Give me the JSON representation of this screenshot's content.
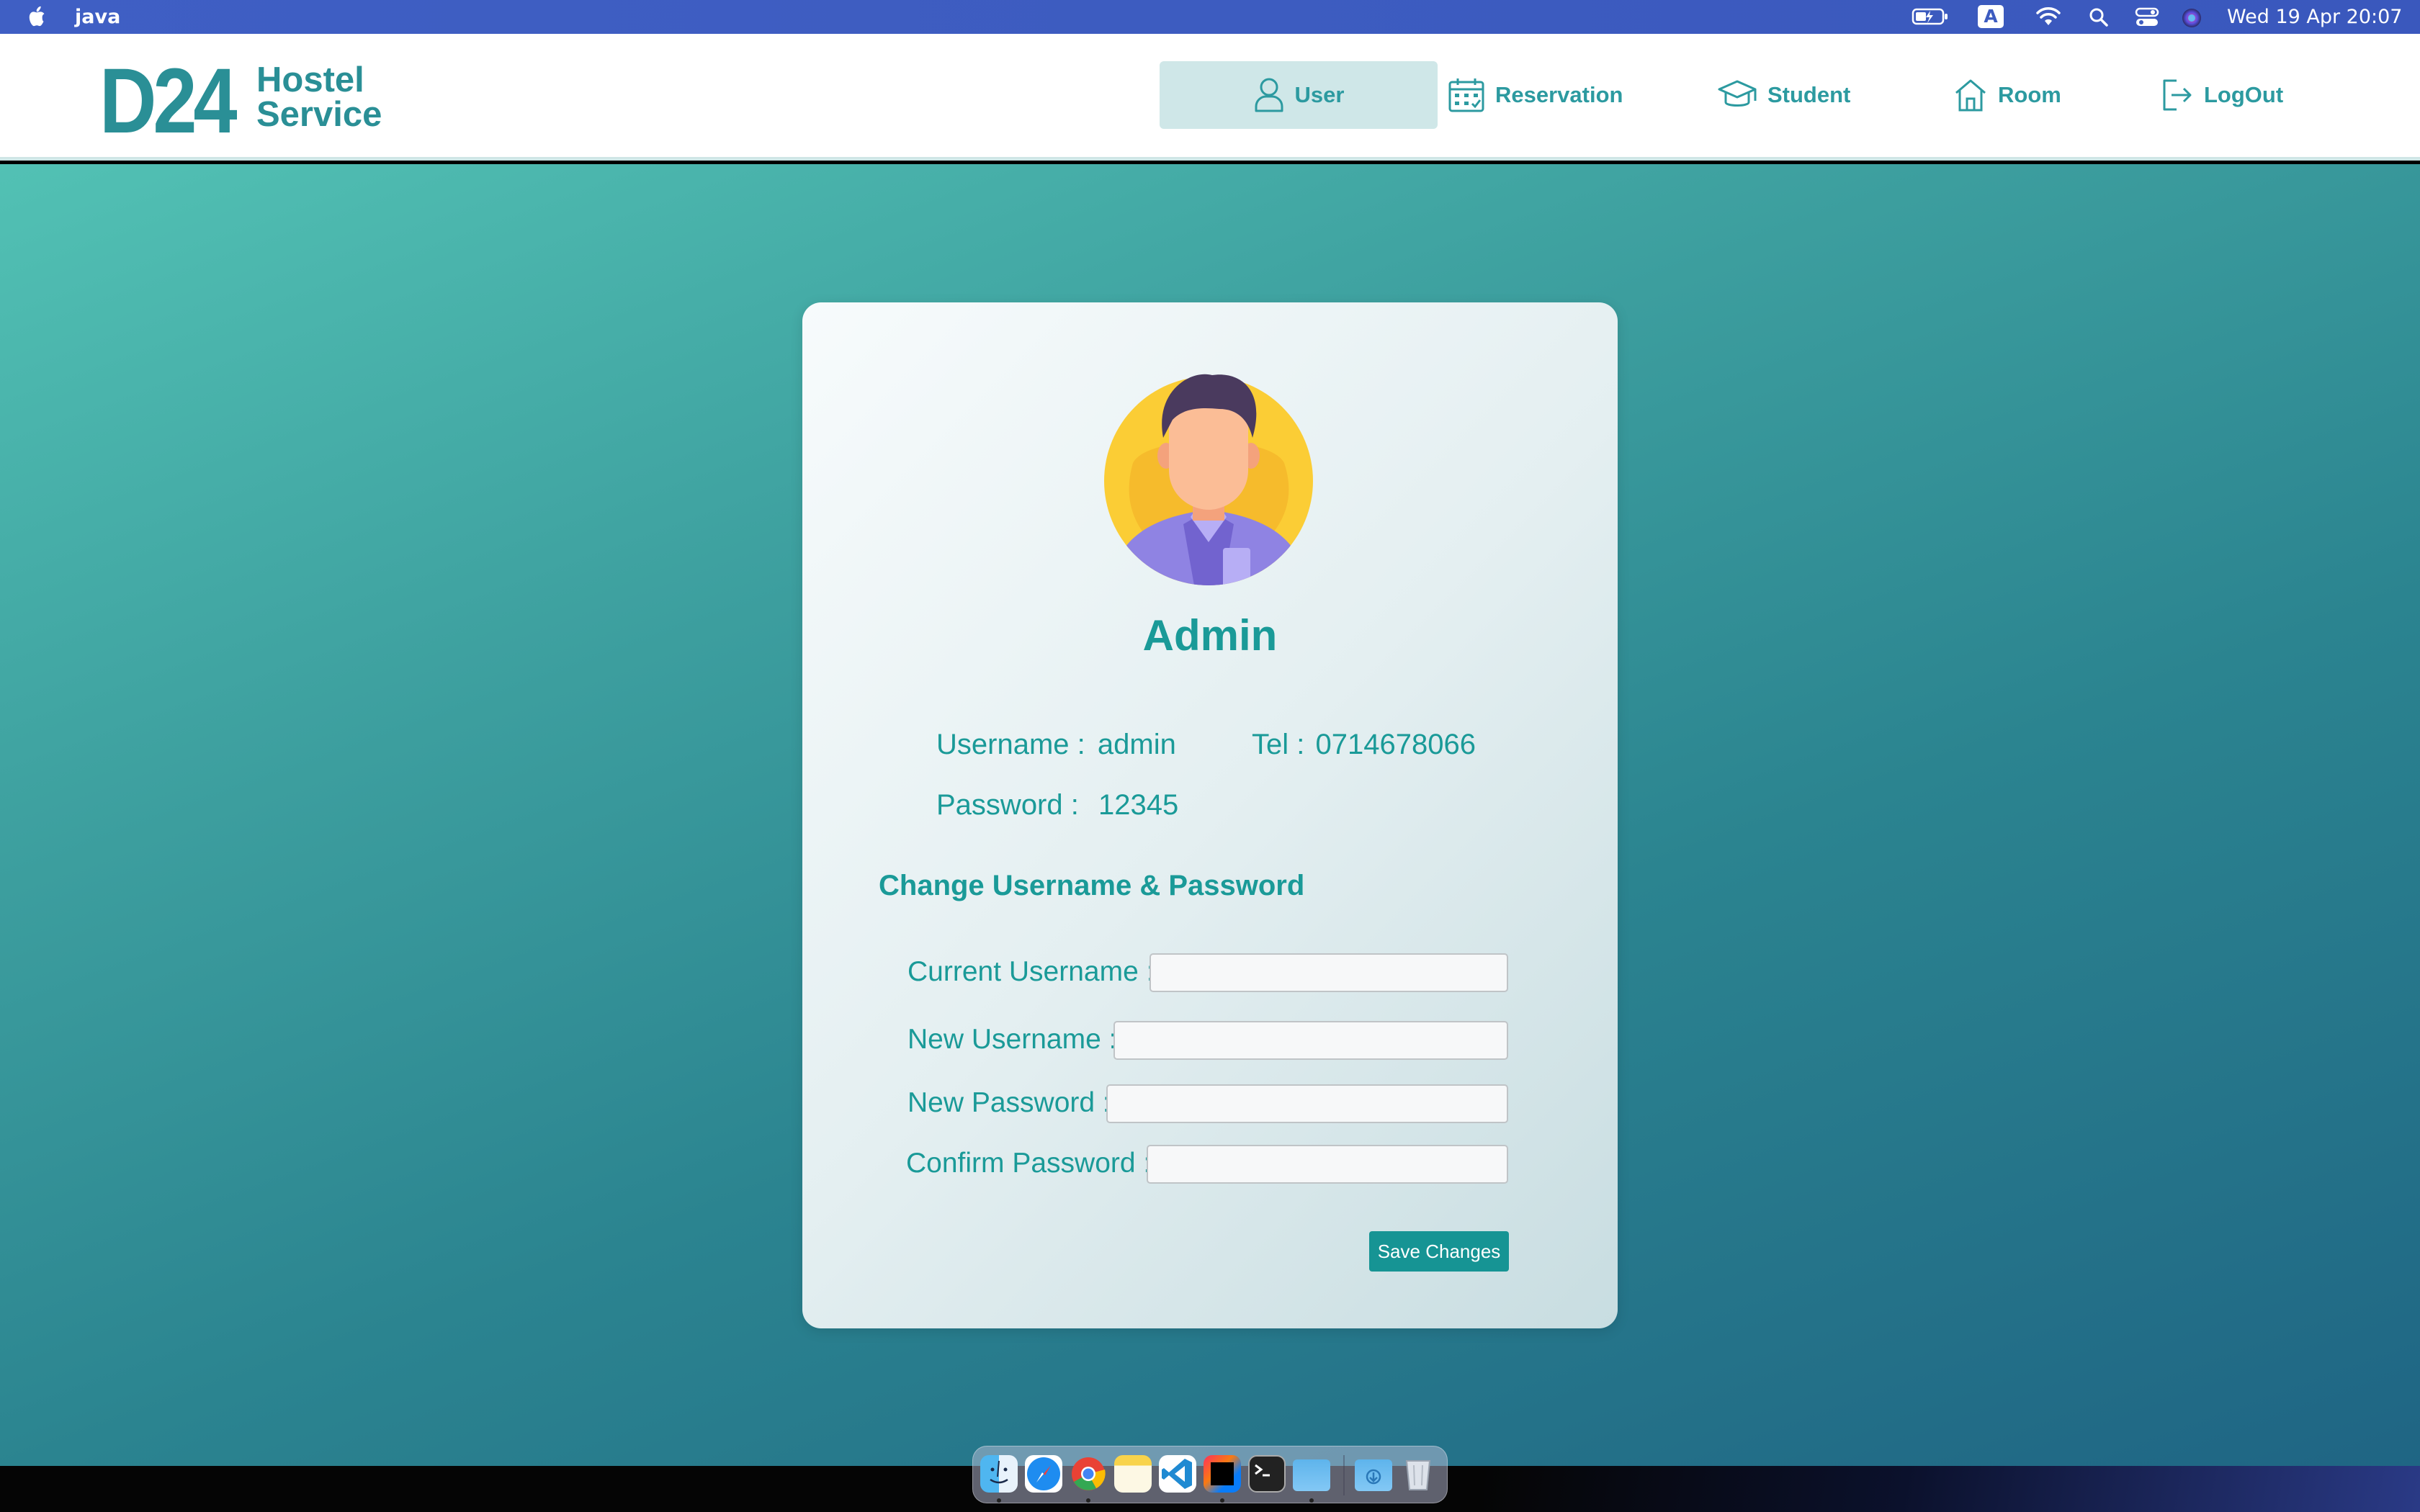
{
  "menubar": {
    "app_name": "java",
    "input_source": "A",
    "clock": "Wed 19 Apr  20:07"
  },
  "logo": {
    "mark": "D24",
    "line1": "Hostel",
    "line2": "Service"
  },
  "nav": {
    "items": [
      {
        "label": "User",
        "icon": "user-icon",
        "active": true
      },
      {
        "label": "Reservation",
        "icon": "calendar-icon",
        "active": false
      },
      {
        "label": "Student",
        "icon": "graduation-cap-icon",
        "active": false
      },
      {
        "label": "Room",
        "icon": "home-icon",
        "active": false
      },
      {
        "label": "LogOut",
        "icon": "logout-icon",
        "active": false
      }
    ]
  },
  "profile": {
    "name": "Admin",
    "username_label": "Username :",
    "username_value": "admin",
    "tel_label": "Tel :",
    "tel_value": "0714678066",
    "password_label": "Password :",
    "password_value": "12345"
  },
  "form": {
    "title": "Change Username & Password",
    "current_username_label": "Current Username :",
    "current_username_value": "",
    "new_username_label": "New Username :",
    "new_username_value": "",
    "new_password_label": "New Password :",
    "new_password_value": "",
    "confirm_password_label": "Confirm Password :",
    "confirm_password_value": "",
    "save_label": "Save Changes"
  },
  "dock": {
    "apps": [
      "finder-icon",
      "safari-icon",
      "chrome-icon",
      "notes-icon",
      "vscode-icon",
      "intellij-icon",
      "terminal-icon",
      "folder-icon",
      "downloads-icon",
      "trash-icon"
    ]
  },
  "colors": {
    "accent": "#1a9a98",
    "nav_active_bg": "#cfe7e8",
    "button": "#169494",
    "menubar": "#3f5fc4"
  }
}
